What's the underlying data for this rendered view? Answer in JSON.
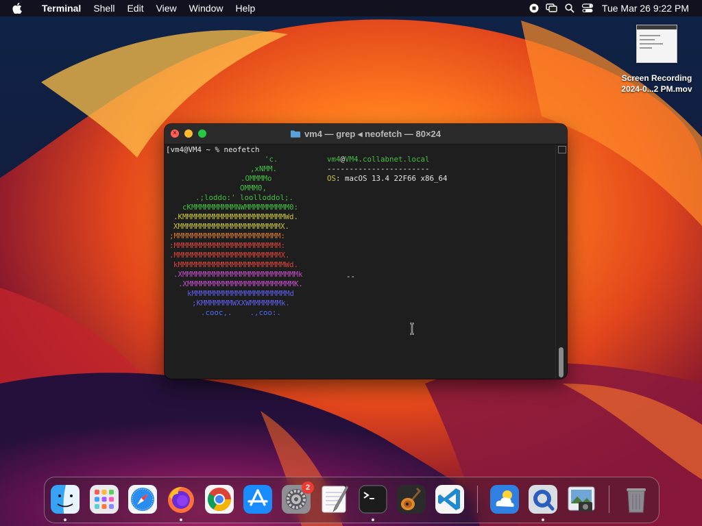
{
  "menubar": {
    "app_name": "Terminal",
    "items": [
      "Shell",
      "Edit",
      "View",
      "Window",
      "Help"
    ],
    "clock": "Tue Mar 26  9:22 PM"
  },
  "desktop_file": {
    "label_line1": "Screen Recording",
    "label_line2": "2024-0...2 PM.mov"
  },
  "terminal": {
    "title": "vm4 — grep ◂ neofetch — 80×24",
    "prompt": "[vm4@VM4 ~ % neofetch",
    "user_host": "vm4@VM4.collabnet.local",
    "user": "vm4",
    "at": "@",
    "host": "VM4.collabnet.local",
    "separator": "-----------------------",
    "os_label": "OS",
    "os_value": ": macOS 13.4 22F66 x86_64",
    "dash": "--",
    "logo": [
      {
        "text": "'c.",
        "color": "green"
      },
      {
        "text": ",xNMM.",
        "color": "green"
      },
      {
        "text": ".OMMMMo",
        "color": "green"
      },
      {
        "text": "OMMM0,",
        "color": "green"
      },
      {
        "text": ".;loddo:' loolloddol;.",
        "color": "green"
      },
      {
        "text": "cKMMMMMMMMMMNWMMMMMMMMMM0:",
        "color": "green"
      },
      {
        "text": ".KMMMMMMMMMMMMMMMMMMMMMMMWd.",
        "color": "yellow"
      },
      {
        "text": "XMMMMMMMMMMMMMMMMMMMMMMMX.",
        "color": "yellow"
      },
      {
        "text": ";MMMMMMMMMMMMMMMMMMMMMMMM:",
        "color": "orange"
      },
      {
        "text": ":MMMMMMMMMMMMMMMMMMMMMMMM:",
        "color": "red"
      },
      {
        "text": ".MMMMMMMMMMMMMMMMMMMMMMMMX.",
        "color": "red"
      },
      {
        "text": "kMMMMMMMMMMMMMMMMMMMMMMMMWd.",
        "color": "red"
      },
      {
        "text": ".XMMMMMMMMMMMMMMMMMMMMMMMMMMk",
        "color": "magenta"
      },
      {
        "text": ".XMMMMMMMMMMMMMMMMMMMMMMMMK.",
        "color": "magenta"
      },
      {
        "text": "kMMMMMMMMMMMMMMMMMMMMMMd",
        "color": "blue"
      },
      {
        "text": ";KMMMMMMMWXXWMMMMMMMk.",
        "color": "blue"
      },
      {
        "text": ".cooc,.    .,coo:.",
        "color": "blue"
      }
    ]
  },
  "dock": {
    "items": [
      "Finder",
      "Launchpad",
      "Safari",
      "Firefox",
      "Chrome",
      "App Store",
      "System Settings",
      "TextEdit",
      "Terminal",
      "GarageBand",
      "Visual Studio Code",
      "Weather",
      "QuickTime Player",
      "Preview",
      "Trash"
    ],
    "settings_badge": "2"
  }
}
